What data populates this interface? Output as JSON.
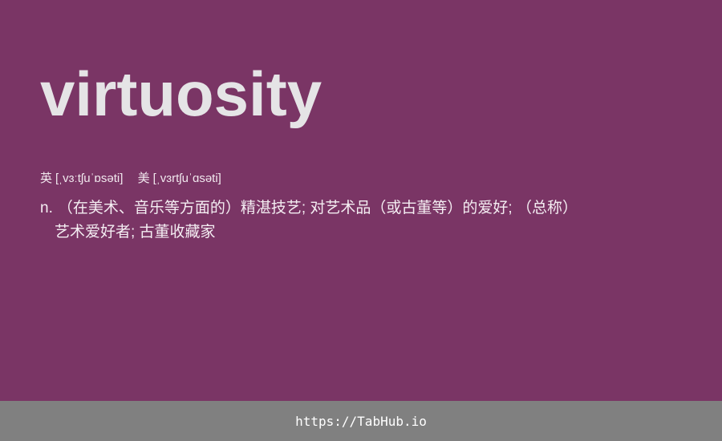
{
  "card": {
    "word": "virtuosity",
    "phonetics": {
      "uk_label": "英",
      "uk_ipa": "[ˌvɜːtʃuˈɒsəti]",
      "us_label": "美",
      "us_ipa": "[ˌvɜrtʃuˈɑsəti]"
    },
    "definition": {
      "pos": "n.",
      "line1": "（在美术、音乐等方面的）精湛技艺; 对艺术品（或古董等）的爱好; （总称）",
      "line2": "艺术爱好者; 古董收藏家"
    }
  },
  "footer": {
    "link_text": "https://TabHub.io"
  },
  "colors": {
    "background": "#7a3565",
    "footer_background": "#808080",
    "word_text": "#e5e4e6"
  }
}
